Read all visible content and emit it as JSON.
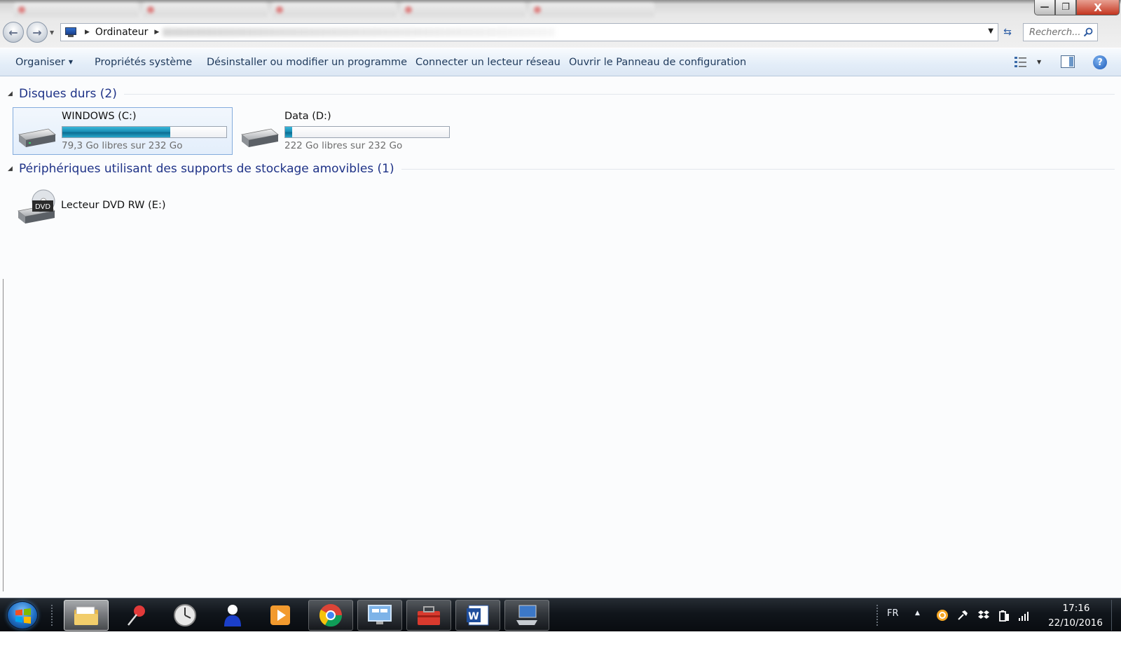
{
  "window": {
    "controls": {
      "minimize": "—",
      "maximize": "❐",
      "close": "X"
    }
  },
  "nav": {
    "breadcrumb": [
      "Ordinateur"
    ],
    "search_placeholder": "Recherch..."
  },
  "toolbar": {
    "organize": "Organiser",
    "system_properties": "Propriétés système",
    "uninstall": "Désinstaller ou modifier un programme",
    "map_drive": "Connecter un lecteur réseau",
    "control_panel": "Ouvrir le Panneau de configuration",
    "help": "?"
  },
  "groups": {
    "hard_disks": {
      "title": "Disques durs (2)"
    },
    "removable": {
      "title": "Périphériques utilisant des supports de stockage amovibles (1)"
    }
  },
  "drives": [
    {
      "name": "WINDOWS (C:)",
      "free_text": "79,3 Go libres sur 232 Go",
      "used_fraction": 0.658,
      "selected": true
    },
    {
      "name": "Data (D:)",
      "free_text": "222 Go libres sur 232 Go",
      "used_fraction": 0.043,
      "selected": false
    }
  ],
  "removable_devices": [
    {
      "name": "Lecteur DVD RW (E:)",
      "icon_text": "DVD"
    }
  ],
  "taskbar": {
    "apps": [
      "explorer-icon",
      "pushpin-icon",
      "clock-app-icon",
      "contacts-icon",
      "media-player-icon",
      "chrome-icon",
      "remote-desktop-icon",
      "toolbox-icon",
      "word-icon",
      "network-computer-icon"
    ],
    "tray": {
      "language": "FR",
      "icons": [
        "show-hidden-icons-icon",
        "update-icon",
        "pin-icon",
        "dropbox-icon",
        "power-icon",
        "network-signal-icon"
      ],
      "time": "17:16",
      "date": "22/10/2016"
    }
  },
  "colors": {
    "group_heading": "#1e3287",
    "command_text": "#1e395b",
    "drive_bar": "#1a8fb6",
    "selection_border": "#84acdd"
  }
}
